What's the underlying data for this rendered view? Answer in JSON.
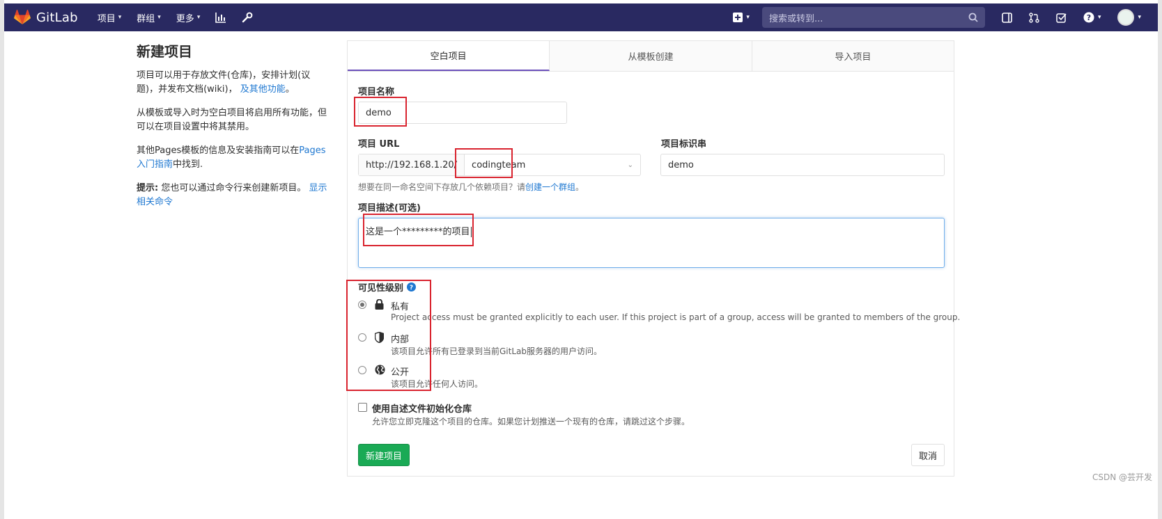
{
  "navbar": {
    "brand": "GitLab",
    "menus": [
      {
        "label": "项目"
      },
      {
        "label": "群组"
      },
      {
        "label": "更多"
      }
    ],
    "search_placeholder": "搜索或转到..."
  },
  "left": {
    "title": "新建项目",
    "p1_text": "项目可以用于存放文件(仓库)，安排计划(议题)，并发布文档(wiki)，",
    "p1_link": "及其他功能",
    "p1_end": "。",
    "p2": "从模板或导入时为空白项目将启用所有功能，但可以在项目设置中将其禁用。",
    "p3_text": "其他Pages模板的信息及安装指南可以在",
    "p3_link": "Pages入门指南",
    "p3_end": "中找到.",
    "tip_label": "提示:",
    "tip_text": "您也可以通过命令行来创建新项目。",
    "tip_link": "显示相关命令"
  },
  "tabs": [
    {
      "label": "空白项目",
      "active": true
    },
    {
      "label": "从模板创建",
      "active": false
    },
    {
      "label": "导入项目",
      "active": false
    }
  ],
  "form": {
    "name_label": "项目名称",
    "name_value": "demo",
    "url_label": "项目 URL",
    "url_prefix": "http://192.168.1.20/",
    "namespace_value": "codingteam",
    "slug_label": "项目标识串",
    "slug_value": "demo",
    "url_hint_text": "想要在同一命名空间下存放几个依赖项目？请",
    "url_hint_link": "创建一个群组",
    "url_hint_end": "。",
    "desc_label": "项目描述(可选)",
    "desc_value": "这是一个*********的项目",
    "visibility_label": "可见性级别",
    "visibility": [
      {
        "title": "私有",
        "desc": "Project access must be granted explicitly to each user. If this project is part of a group, access will be granted to members of the group.",
        "checked": true
      },
      {
        "title": "内部",
        "desc": "该项目允许所有已登录到当前GitLab服务器的用户访问。",
        "checked": false
      },
      {
        "title": "公开",
        "desc": "该项目允许任何人访问。",
        "checked": false
      }
    ],
    "readme_label": "使用自述文件初始化仓库",
    "readme_desc": "允许您立即克隆这个项目的仓库。如果您计划推送一个现有的仓库，请跳过这个步骤。",
    "submit_label": "新建项目",
    "cancel_label": "取消"
  },
  "watermark": "CSDN @芸开发",
  "colors": {
    "navbar": "#292961",
    "primary": "#1aaa55",
    "link": "#1f78d1",
    "highlight_box": "#d9232e"
  }
}
